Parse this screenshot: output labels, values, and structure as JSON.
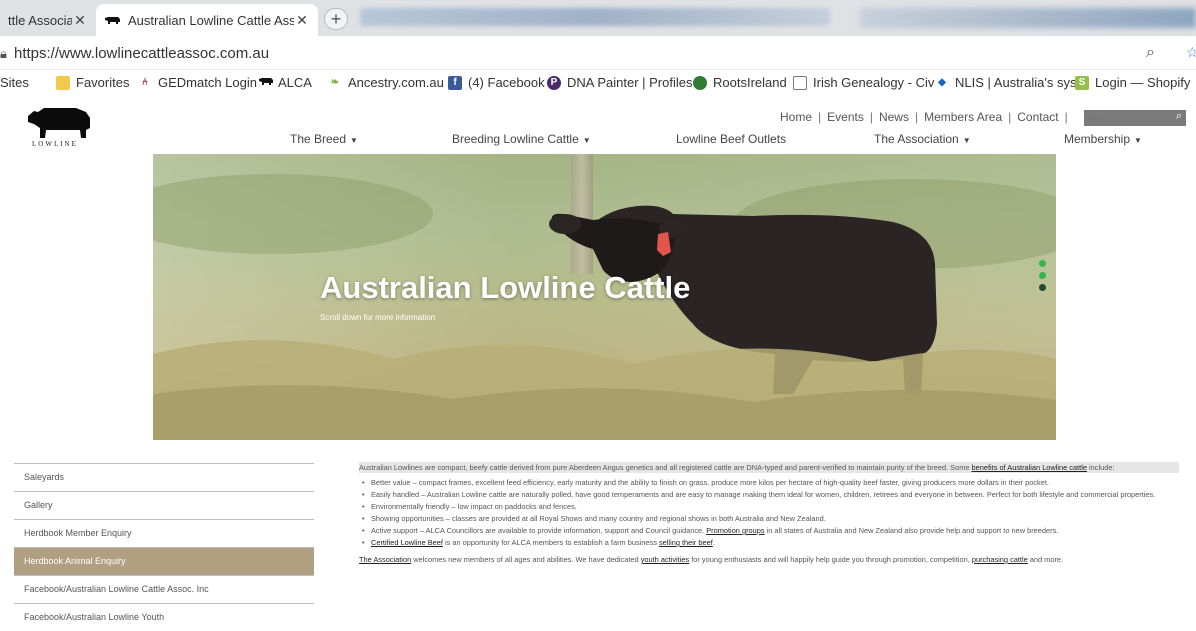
{
  "browser": {
    "tabs": [
      {
        "title": "ttle Associa",
        "close": "✕"
      },
      {
        "title": "Australian Lowline Cattle Associa",
        "close": "✕"
      }
    ],
    "new_tab": "+",
    "url": "https://www.lowlinecattleassoc.com.au",
    "bookmarks": [
      {
        "label": "Sites",
        "icon": "apps-icon"
      },
      {
        "label": "Favorites",
        "icon": "folder-icon"
      },
      {
        "label": "GEDmatch Login",
        "icon": "gedmatch-icon"
      },
      {
        "label": "ALCA",
        "icon": "cattle-icon"
      },
      {
        "label": "Ancestry.com.au",
        "icon": "ancestry-leaf-icon"
      },
      {
        "label": "(4) Facebook",
        "icon": "facebook-icon"
      },
      {
        "label": "DNA Painter | Profiles",
        "icon": "dna-painter-icon"
      },
      {
        "label": "RootsIreland",
        "icon": "roots-icon"
      },
      {
        "label": "Irish Genealogy - Civ",
        "icon": "page-icon"
      },
      {
        "label": "NLIS | Australia's syst",
        "icon": "nlis-icon"
      },
      {
        "label": "Login — Shopify",
        "icon": "shopify-icon"
      }
    ]
  },
  "site": {
    "logo_text": "LOWLINE",
    "top_nav": [
      "Home",
      "Events",
      "News",
      "Members Area",
      "Contact"
    ],
    "search_placeholder": "Search",
    "main_nav": [
      {
        "label": "The Breed",
        "dropdown": true
      },
      {
        "label": "Breeding Lowline Cattle",
        "dropdown": true
      },
      {
        "label": "Lowline Beef Outlets",
        "dropdown": false
      },
      {
        "label": "The Association",
        "dropdown": true
      },
      {
        "label": "Membership",
        "dropdown": true
      }
    ],
    "hero": {
      "title": "Australian Lowline Cattle",
      "subtitle": "Scroll down for more information"
    },
    "sidebar": [
      {
        "label": "Saleyards",
        "active": false
      },
      {
        "label": "Gallery",
        "active": false
      },
      {
        "label": "Herdbook Member Enquiry",
        "active": false
      },
      {
        "label": "Herdbook Animal Enquiry",
        "active": true
      },
      {
        "label": "Facebook/Australian Lowline Cattle Assoc. Inc",
        "active": false
      },
      {
        "label": "Facebook/Australian Lowline Youth",
        "active": false
      }
    ],
    "content": {
      "intro_text": "Australian Lowlines are compact, beefy cattle derived from pure Aberdeen Angus genetics and all registered cattle are DNA-typed and parent-verified to maintain purity of the breed. Some ",
      "intro_link": "benefits of Australian Lowline cattle",
      "intro_tail": " include:",
      "bullets": [
        {
          "text": "Better value – compact frames, excellent feed efficiency, early maturity and the ability to finish on grass, produce more kilos per hectare of high-quality beef faster, giving producers more dollars in their pocket."
        },
        {
          "text": "Easily handled – Australian Lowline cattle are naturally polled, have good temperaments and are easy to manage making them ideal for women, children, retirees and everyone in between. Perfect for both lifestyle and commercial properties."
        },
        {
          "text": "Environmentally friendly – low impact on paddocks and fences."
        },
        {
          "text": "Showing opportunities – classes are provided at all Royal Shows and many country and regional shows in both Australia and New Zealand."
        },
        {
          "pre": "Active support – ALCA Councillors are available to provide information, support and Council guidance. ",
          "link": "Promotion groups",
          "post": " in all states of Australia and New Zealand also provide help and support to new breeders."
        },
        {
          "link": "Certified Lowline Beef",
          "mid": " is an opportunity for ALCA members to establish a farm business ",
          "link2": "selling their beef",
          "post": "."
        }
      ],
      "assoc_link": "The Association",
      "assoc_mid1": " welcomes new members of all ages and abilities. We have dedicated ",
      "assoc_link2": "youth activities",
      "assoc_mid2": " for young enthusiasts and will happily help guide you through promotion, competition, ",
      "assoc_link3": "purchasing cattle",
      "assoc_tail": " and more."
    }
  }
}
